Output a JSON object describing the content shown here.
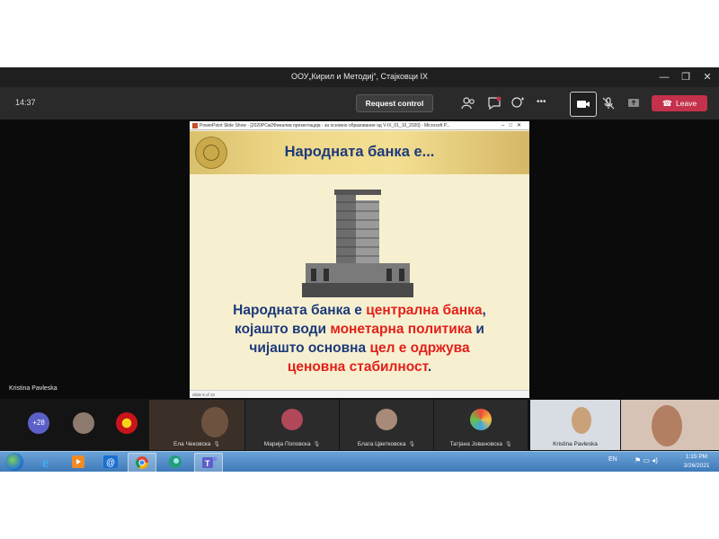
{
  "window": {
    "title": "ООУ„Кирил и Методиј“, Стајковци IX",
    "minimize": "—",
    "restore": "❐",
    "close": "✕"
  },
  "meeting": {
    "elapsed": "14:37",
    "request_control": "Request control",
    "leave_label": "Leave",
    "more_label": "•••"
  },
  "slide": {
    "window_title": "PowerPoint Slide Show - [2020РСм2Финалиа презентација - за основно образование од V-IX_01_10_2020] - Microsoft P...",
    "title": "Народната банка е...",
    "line1_a": "Народната банка е ",
    "line1_b": "централна банка",
    "line1_c": ",",
    "line2_a": "којашто води ",
    "line2_b": "монетарна политика",
    "line2_c": " и",
    "line3_a": "чијашто основна ",
    "line3_b": "цел е одржува",
    "line4_a": "ценовна стабилност",
    "line4_b": ".",
    "footer": "Slide 5 of 10"
  },
  "presenter_name": "Kristina Pavleska",
  "participants": {
    "more_count": "+28",
    "tiles": [
      {
        "name": "Ела Чековска"
      },
      {
        "name": "Марија Поповска"
      },
      {
        "name": "Блага Цветковска"
      },
      {
        "name": "Татјана Јовановска"
      },
      {
        "name": "Kristina Pavleska"
      }
    ]
  },
  "taskbar": {
    "lang": "EN",
    "time": "1:15 PM",
    "date": "3/26/2021"
  },
  "colors": {
    "leave": "#c4314b",
    "accent": "#5b5fc7",
    "slide_blue": "#1d3a7a",
    "slide_red": "#e3201b"
  }
}
